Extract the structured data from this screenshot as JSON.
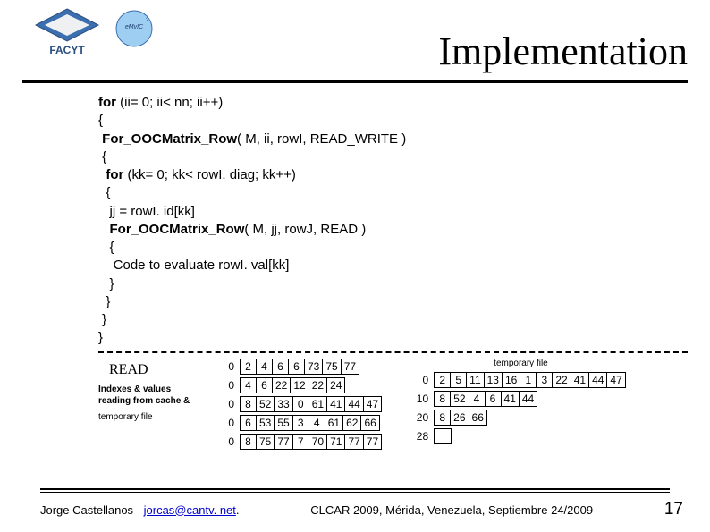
{
  "header": {
    "title": "Implementation",
    "logo1_alt": "FACYT",
    "logo2_alt": "eMvIC²"
  },
  "code": {
    "l1a": "for ",
    "l1b": "(ii= 0; ii< nn; ii++)",
    "l2": "{",
    "l3a": " For_OOCMatrix_Row",
    "l3b": "( M, ii, rowI, READ_WRITE )",
    "l4": " {",
    "l5a": "  for ",
    "l5b": "(kk= 0; kk< rowI. diag; kk++)",
    "l6": "  {",
    "l7": "   jj = rowI. id[kk]",
    "l8a": "   For_OOCMatrix_Row",
    "l8b": "( M, jj, rowJ, READ )",
    "l9": "   {",
    "l10": "    Code to evaluate rowI. val[kk]",
    "l11": "   }",
    "l12": "  }",
    "l13": " }",
    "l14": "}"
  },
  "diagram": {
    "read_label": "READ",
    "idx_label": "Indexes & values reading from cache &",
    "temp_label_left": "temporary file",
    "temp_label_right": "temporary file",
    "left_rows": [
      {
        "idx": "0",
        "cells": [
          "2",
          "4",
          "6",
          "6",
          "73",
          "75",
          "77"
        ]
      },
      {
        "idx": "0",
        "cells": [
          "4",
          "6",
          "22",
          "12",
          "22",
          "24"
        ]
      },
      {
        "idx": "0",
        "cells": [
          "8",
          "52",
          "33",
          "0",
          "61",
          "41",
          "44",
          "47"
        ]
      },
      {
        "idx": "0",
        "cells": [
          "6",
          "53",
          "55",
          "3",
          "4",
          "61",
          "62",
          "66"
        ]
      },
      {
        "idx": "0",
        "cells": [
          "8",
          "75",
          "77",
          "7",
          "70",
          "71",
          "77",
          "77"
        ]
      }
    ],
    "right_rows": [
      {
        "idx": "0",
        "cells": [
          "2",
          "5",
          "11",
          "13",
          "16",
          "1",
          "3",
          "22",
          "41",
          "44",
          "47"
        ]
      },
      {
        "idx": "10",
        "cells": [
          "8",
          "52",
          "4",
          "6",
          "41",
          "44"
        ]
      },
      {
        "idx": "20",
        "cells": [
          "8",
          "26",
          "66"
        ]
      },
      {
        "idx": "28",
        "cells": []
      }
    ]
  },
  "footer": {
    "author": "Jorge Castellanos - ",
    "email": "jorcas@cantv. net",
    "period": ".",
    "conf": "CLCAR 2009, Mérida, Venezuela, Septiembre 24/2009",
    "page": "17"
  }
}
